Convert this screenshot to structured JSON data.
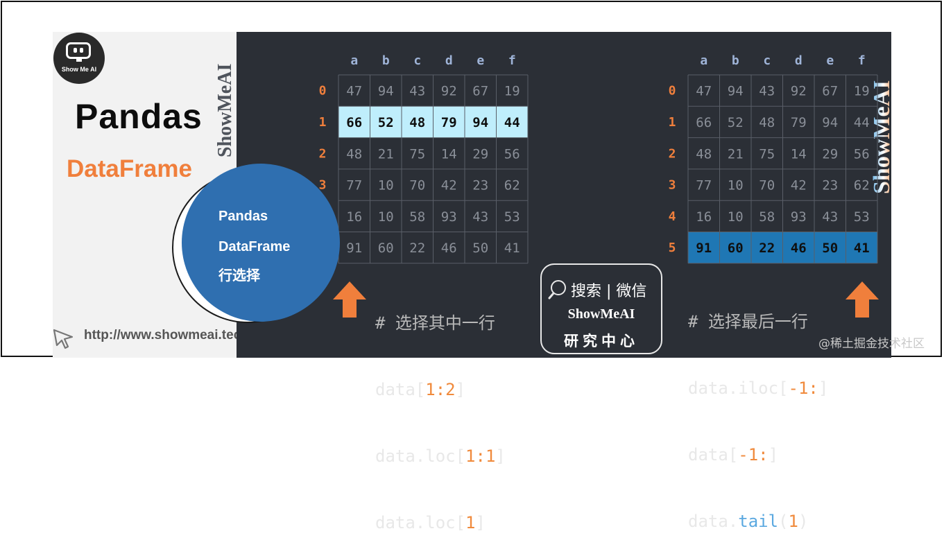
{
  "branding": {
    "logo_text": "Show Me AI",
    "watermark": "ShowMeAI",
    "url": "http://www.showmeai.tech",
    "credit": "@稀土掘金技术社区"
  },
  "title": {
    "main": "Pandas",
    "sub": "DataFrame"
  },
  "circle": {
    "line1": "Pandas",
    "line2": "DataFrame",
    "line3": "行选择"
  },
  "table": {
    "columns": [
      "a",
      "b",
      "c",
      "d",
      "e",
      "f"
    ],
    "row_index": [
      "0",
      "1",
      "2",
      "3",
      "4",
      "5"
    ],
    "rows": [
      [
        "47",
        "94",
        "43",
        "92",
        "67",
        "19"
      ],
      [
        "66",
        "52",
        "48",
        "79",
        "94",
        "44"
      ],
      [
        "48",
        "21",
        "75",
        "14",
        "29",
        "56"
      ],
      [
        "77",
        "10",
        "70",
        "42",
        "23",
        "62"
      ],
      [
        "16",
        "10",
        "58",
        "93",
        "43",
        "53"
      ],
      [
        "91",
        "60",
        "22",
        "46",
        "50",
        "41"
      ]
    ]
  },
  "left_example": {
    "highlight_row": 1,
    "highlight_color": "#bfeefc",
    "comment": "# 选择其中一行",
    "code": [
      [
        "data[",
        "1:2",
        "]"
      ],
      [
        "data.loc[",
        "1:1",
        "]"
      ],
      [
        "data.loc[",
        "1",
        "]"
      ]
    ]
  },
  "right_example": {
    "highlight_row": 5,
    "highlight_color": "#1f77b4",
    "comment": "# 选择最后一行",
    "code": [
      [
        "data.iloc[",
        "-1:",
        "]"
      ],
      [
        "data[",
        "-1:",
        "]"
      ],
      [
        "data.",
        "tail",
        "(",
        "1",
        ")"
      ]
    ]
  },
  "search": {
    "label": "搜索 | 微信",
    "brand": "ShowMeAI",
    "org": "研究中心"
  },
  "colors": {
    "accent_orange": "#f07f3c",
    "dark_bg": "#2b2f36",
    "circle_blue": "#2f6fb0"
  }
}
